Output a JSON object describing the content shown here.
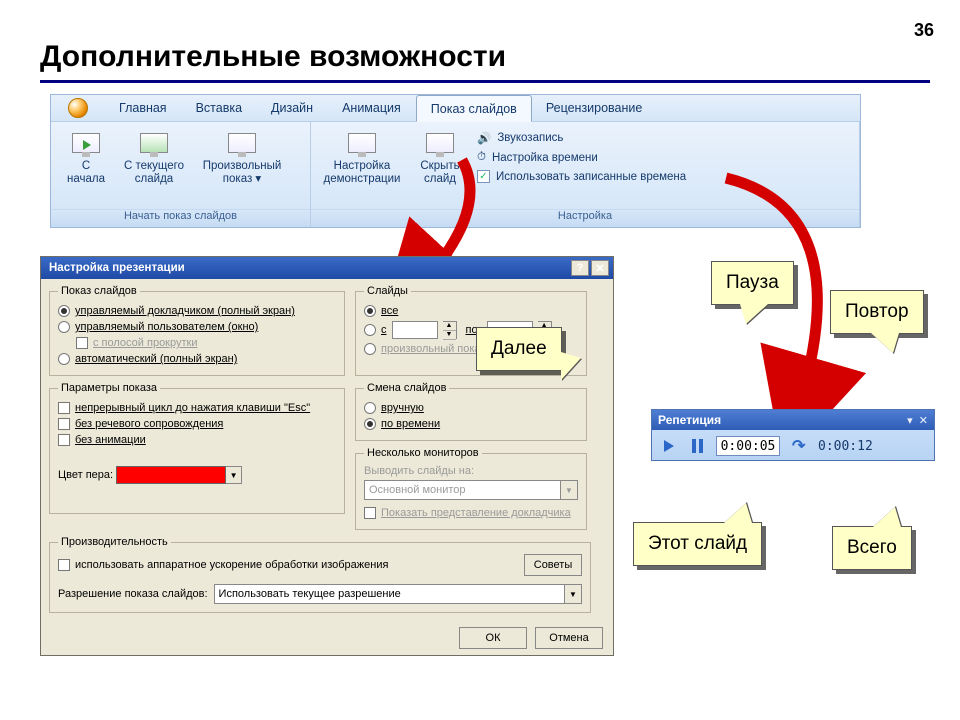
{
  "slide_number": "36",
  "title": "Дополнительные возможности",
  "ribbon": {
    "tabs": [
      "Главная",
      "Вставка",
      "Дизайн",
      "Анимация",
      "Показ слайдов",
      "Рецензирование"
    ],
    "active_index": 4,
    "group1_label": "Начать показ слайдов",
    "group2_label": "Настройка",
    "btn_from_start": "С\nначала",
    "btn_from_current": "С текущего\nслайда",
    "btn_custom": "Произвольный\nпоказ ▾",
    "btn_setup": "Настройка\nдемонстрации",
    "btn_hide": "Скрыть\nслайд",
    "item_record": "Звукозапись",
    "item_rehearse": "Настройка времени",
    "item_use_timings": "Использовать записанные времена"
  },
  "dialog": {
    "title": "Настройка презентации",
    "grp_show": "Показ слайдов",
    "show_speaker": "управляемый докладчиком (полный экран)",
    "show_user": "управляемый пользователем (окно)",
    "show_scrollbar": "с полосой прокрутки",
    "show_kiosk": "автоматический (полный экран)",
    "grp_slides": "Слайды",
    "slides_all": "все",
    "slides_from": "с",
    "slides_to": "по",
    "slides_custom": "произвольный показ:",
    "grp_options": "Параметры показа",
    "opt_loop": "непрерывный цикл до нажатия клавиши \"Esc\"",
    "opt_no_narration": "без речевого сопровождения",
    "opt_no_animation": "без анимации",
    "pen_label": "Цвет пера:",
    "grp_advance": "Смена слайдов",
    "adv_manual": "вручную",
    "adv_timing": "по времени",
    "grp_monitors": "Несколько мониторов",
    "mon_label": "Выводить слайды на:",
    "mon_value": "Основной монитор",
    "mon_presenter": "Показать представление докладчика",
    "grp_perf": "Производительность",
    "perf_hw": "использовать аппаратное ускорение обработки изображения",
    "perf_tips": "Советы",
    "perf_res_label": "Разрешение показа слайдов:",
    "perf_res_value": "Использовать текущее разрешение",
    "ok": "ОК",
    "cancel": "Отмена"
  },
  "rehearsal": {
    "title": "Репетиция",
    "time_current": "0:00:05",
    "time_total": "0:00:12"
  },
  "callouts": {
    "pause": "Пауза",
    "repeat": "Повтор",
    "next": "Далее",
    "this_slide": "Этот слайд",
    "total": "Всего"
  }
}
